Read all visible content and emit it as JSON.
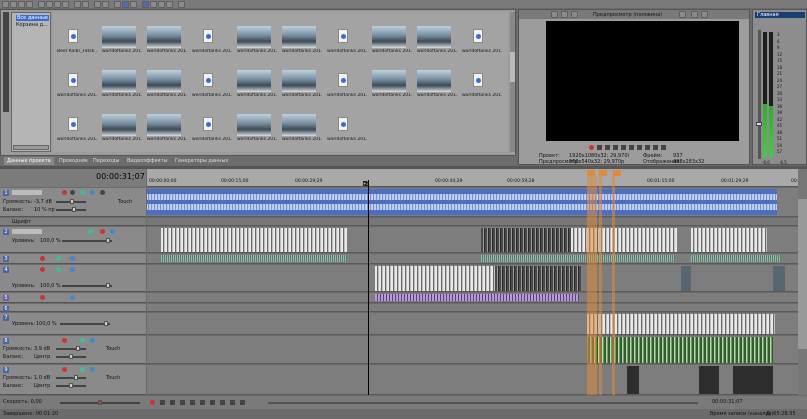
{
  "colors": {
    "accent": "#4d6ea8",
    "audio_blue": "#4c6fc0",
    "marker_orange": "#e08a3c",
    "mixer_header": "#1a3d78"
  },
  "explorer": {
    "tree": [
      "Все данные",
      "Корзина д..."
    ],
    "captions": {
      "first": "Beer Kolbr_Fatsk...",
      "repeat": "worldoftanks 201..."
    }
  },
  "project_tabs": [
    "Данные проекта",
    "Проводник",
    "Переходы",
    "Видеоэффекты",
    "Генераторы данных"
  ],
  "preview": {
    "mode_label": "Предпросмотр (половина)",
    "info": {
      "project_label": "Проект:",
      "project_value": "1920x1080x32; 29,970i",
      "preview_label": "Предпросмотр:",
      "preview_value": "960x540x32; 29,970p",
      "frame_label": "Фрейм:",
      "frame_value": "937",
      "display_label": "Отображение:",
      "display_value": "488x283x32"
    }
  },
  "mixer": {
    "title": "Главная",
    "scale": [
      "3",
      "6",
      "9",
      "12",
      "15",
      "18",
      "21",
      "24",
      "27",
      "30",
      "33",
      "36",
      "39",
      "42",
      "45",
      "48",
      "51",
      "54",
      "57"
    ],
    "bottom": [
      "-6.6",
      "-6.5"
    ]
  },
  "timeline": {
    "timecode": "00:00:31;07",
    "ruler": [
      "00:00:00;00",
      "00:00:15;00",
      "00:00:29;29",
      "00:00:44;29",
      "00:00:59;28",
      "00:01:15;00",
      "00:01:29;29",
      "00:01:44;29",
      "00:01:59;28"
    ],
    "cursor_label": "+3",
    "tracks": {
      "t1": {
        "vol_label": "Громкость:",
        "vol_value": "-3,7 dB",
        "pan_label": "Баланс:",
        "pan_value": "10 % пр",
        "fx": "Touch"
      },
      "bus": {
        "label": "Шрифт"
      },
      "t2": {
        "num": "2",
        "level_label": "Уровень:",
        "level_value": "100,0 %"
      },
      "t3": {
        "num": "3"
      },
      "t4": {
        "num": "4",
        "level_label": "Уровень:",
        "level_value": "100,0 %"
      },
      "t5": {
        "num": "5"
      },
      "t6": {
        "num": "6"
      },
      "t7": {
        "num": "7",
        "level_label": "Уровень:",
        "level_value": "100,0 %"
      },
      "t8": {
        "num": "8",
        "vol_label": "Громкость:",
        "vol_value": "3,9 dB",
        "pan_label": "Баланс:",
        "pan_value": "Центр",
        "fx": "Touch"
      },
      "t9": {
        "num": "9",
        "vol_label": "Громкость:",
        "vol_value": "1,0 dB",
        "pan_label": "Баланс:",
        "pan_value": "Центр",
        "fx": "Touch"
      }
    }
  },
  "transport": {
    "speed_label": "Скорость: 0,00",
    "position": "00:00:31;07"
  },
  "status": {
    "left": "Завершено: 00:01:20",
    "right": "Время записи (каналов):",
    "right_value": "Д: 65:28:35"
  }
}
